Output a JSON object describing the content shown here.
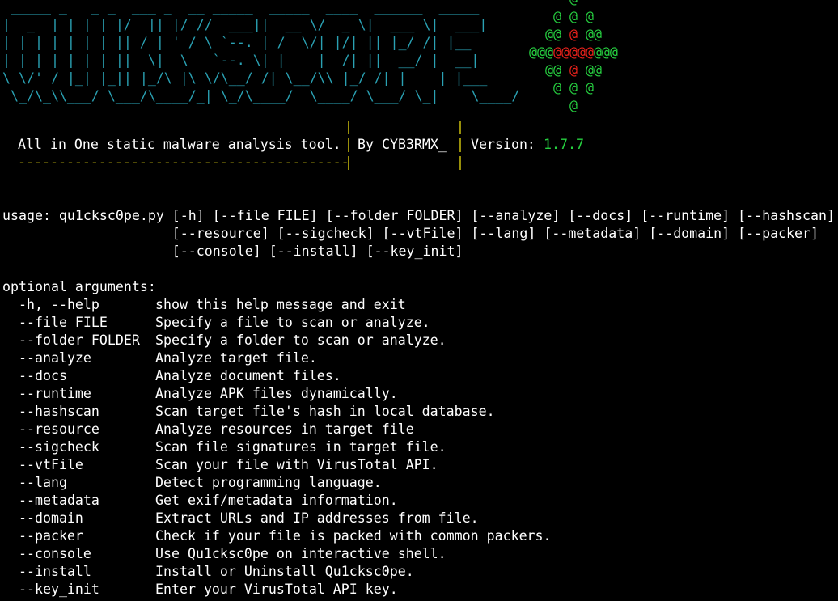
{
  "banner": {
    "logo_lines": [
      " _____ _   _ _  ___ _  __ _____  _____  ____  ______  _____ ",
      "|  _  | | | | |/  || |/ //  ___||  __ \\/  _ \\|  ___ \\|  ___|",
      "| | | | | | | || / | ' / \\ `--. | /  \\/| |/| || |_/ /| |__  ",
      "| | | | | | | ||  \\|  \\   `--. \\| |    |  /| ||  __/ |  __| ",
      "\\ \\/' / |_| |_|| |_/\\ |\\ \\/\\__/ /| \\__/\\\\ |_/ /| |    | |___ ",
      " \\_/\\_\\\\___/ \\___/\\____/_| \\_/\\____/  \\____/ \\___/ \\_|    \\____/ "
    ],
    "art": [
      [
        {
          "t": "@",
          "c": "green"
        }
      ],
      [
        {
          "t": "@ @ @",
          "c": "green"
        }
      ],
      [
        {
          "t": "@@ ",
          "c": "green"
        },
        {
          "t": "@",
          "c": "red"
        },
        {
          "t": " @@",
          "c": "green"
        }
      ],
      [
        {
          "t": "@@@",
          "c": "green"
        },
        {
          "t": "@@@@@",
          "c": "red"
        },
        {
          "t": "@@@",
          "c": "green"
        }
      ],
      [
        {
          "t": "@@ ",
          "c": "green"
        },
        {
          "t": "@",
          "c": "red"
        },
        {
          "t": " @@",
          "c": "green"
        }
      ],
      [
        {
          "t": "@ @ @",
          "c": "green"
        }
      ],
      [
        {
          "t": "@",
          "c": "green"
        }
      ]
    ],
    "description": "All in One static malware analysis tool.",
    "author": "By CYB3RMX_",
    "version_label": "Version:",
    "version": "1.7.7",
    "underline": "-----------------------------------------",
    "separator": "|"
  },
  "usage": {
    "lines": [
      "usage: qu1cksc0pe.py [-h] [--file FILE] [--folder FOLDER] [--analyze] [--docs] [--runtime] [--hashscan]",
      "                     [--resource] [--sigcheck] [--vtFile] [--lang] [--metadata] [--domain] [--packer]",
      "                     [--console] [--install] [--key_init]"
    ]
  },
  "optional": {
    "heading": "optional arguments:",
    "items": [
      {
        "flag": "-h, --help",
        "desc": "show this help message and exit"
      },
      {
        "flag": "--file FILE",
        "desc": "Specify a file to scan or analyze."
      },
      {
        "flag": "--folder FOLDER",
        "desc": "Specify a folder to scan or analyze."
      },
      {
        "flag": "--analyze",
        "desc": "Analyze target file."
      },
      {
        "flag": "--docs",
        "desc": "Analyze document files."
      },
      {
        "flag": "--runtime",
        "desc": "Analyze APK files dynamically."
      },
      {
        "flag": "--hashscan",
        "desc": "Scan target file's hash in local database."
      },
      {
        "flag": "--resource",
        "desc": "Analyze resources in target file"
      },
      {
        "flag": "--sigcheck",
        "desc": "Scan file signatures in target file."
      },
      {
        "flag": "--vtFile",
        "desc": "Scan your file with VirusTotal API."
      },
      {
        "flag": "--lang",
        "desc": "Detect programming language."
      },
      {
        "flag": "--metadata",
        "desc": "Get exif/metadata information."
      },
      {
        "flag": "--domain",
        "desc": "Extract URLs and IP addresses from file."
      },
      {
        "flag": "--packer",
        "desc": "Check if your file is packed with common packers."
      },
      {
        "flag": "--console",
        "desc": "Use Qu1cksc0pe on interactive shell."
      },
      {
        "flag": "--install",
        "desc": "Install or Uninstall Qu1cksc0pe."
      },
      {
        "flag": "--key_init",
        "desc": "Enter your VirusTotal API key."
      }
    ]
  },
  "colors": {
    "background": "#000000",
    "text": "#ffffff",
    "logo": "#2aa1b3",
    "accent_green": "#26d040",
    "accent_red": "#e8211b",
    "separator_yellow": "#d4c80f"
  }
}
